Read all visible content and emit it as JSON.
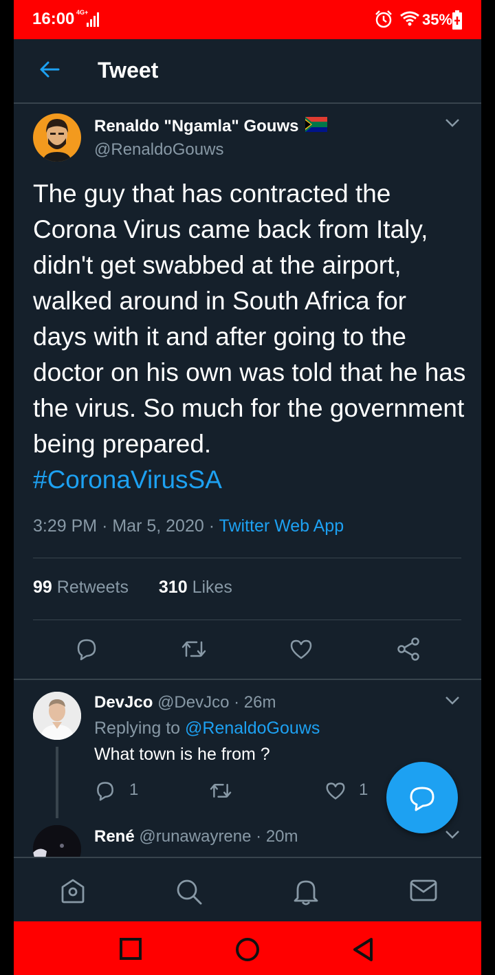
{
  "status_bar": {
    "time": "16:00",
    "network": "4G+",
    "battery": "35%"
  },
  "header": {
    "title": "Tweet"
  },
  "tweet": {
    "author_name": "Renaldo \"Ngamla\" Gouws",
    "author_handle": "@RenaldoGouws",
    "text": "The guy that has contracted the Corona Virus came back from Italy, didn't get swabbed at the airport, walked around in South Africa for days with it and after going to the doctor on his own was told that he has the virus. So much for the government being prepared.",
    "hashtag": "#CoronaVirusSA",
    "time": "3:29 PM",
    "date": "Mar 5, 2020",
    "source": "Twitter Web App",
    "retweets_count": "99",
    "retweets_label": "Retweets",
    "likes_count": "310",
    "likes_label": "Likes"
  },
  "replies": [
    {
      "name": "DevJco",
      "handle": "@DevJco",
      "age": "26m",
      "replying_prefix": "Replying to",
      "replying_to": "@RenaldoGouws",
      "text": "What town is he from ?",
      "reply_count": "1",
      "like_count": "1"
    },
    {
      "name": "René",
      "handle": "@runawayrene",
      "age": "20m"
    }
  ],
  "colors": {
    "background": "#15202b",
    "accent": "#1da1f2",
    "muted": "#8899a6",
    "system_bar": "#ff0000"
  },
  "icons": {
    "nav": [
      "home-icon",
      "search-icon",
      "notifications-icon",
      "messages-icon"
    ],
    "actions": [
      "reply-icon",
      "retweet-icon",
      "like-icon",
      "share-icon"
    ]
  }
}
